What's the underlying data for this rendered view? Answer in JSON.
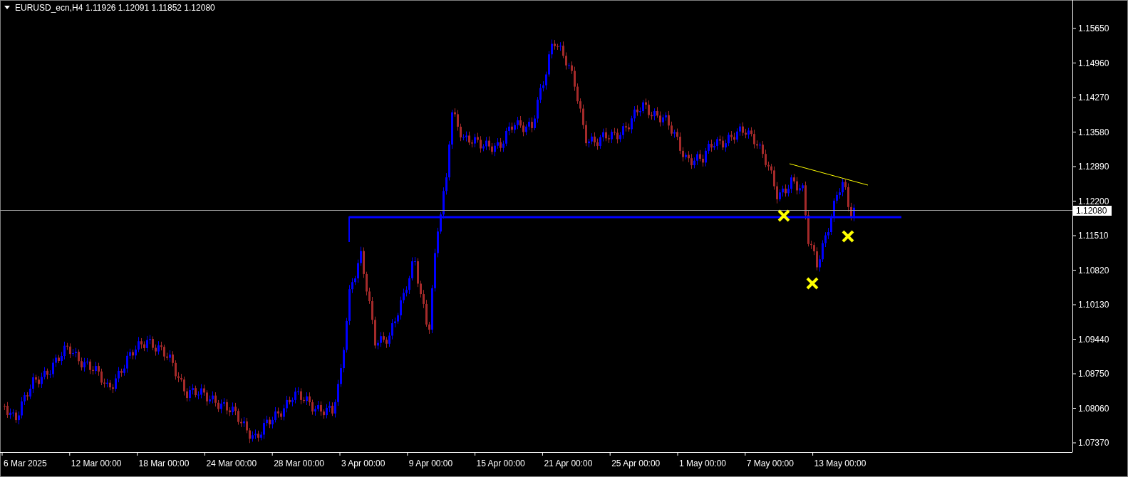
{
  "header": {
    "symbol": "EURUSD_ecn,H4",
    "quotes": "1.11926 1.12091 1.11852 1.12080"
  },
  "price_axis": [
    "1.15650",
    "1.14960",
    "1.14270",
    "1.13580",
    "1.12890",
    "1.12200",
    "1.11510",
    "1.10820",
    "1.10130",
    "1.09440",
    "1.08750",
    "1.08060",
    "1.07370"
  ],
  "current_price": "1.12080",
  "time_axis": [
    "6 Mar 2025",
    "12 Mar 00:00",
    "18 Mar 00:00",
    "24 Mar 00:00",
    "28 Mar 00:00",
    "3 Apr 00:00",
    "9 Apr 00:00",
    "15 Apr 00:00",
    "21 Apr 00:00",
    "25 Apr 00:00",
    "1 May 00:00",
    "7 May 00:00",
    "13 May 00:00"
  ]
}
